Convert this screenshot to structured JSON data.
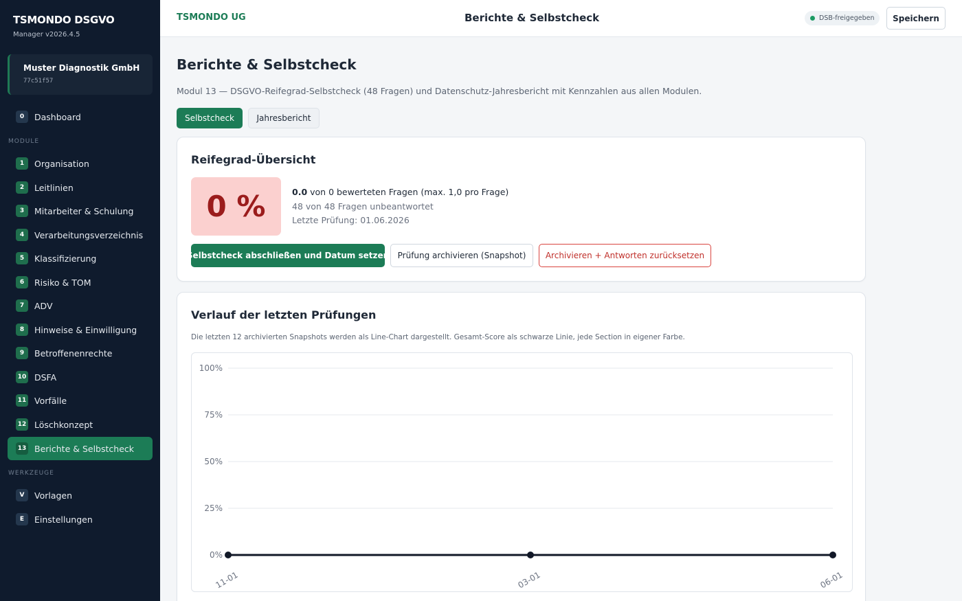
{
  "sidebar": {
    "brand": "TSMONDO DSGVO",
    "version": "Manager v2026.4.5",
    "org": {
      "name": "Muster Diagnostik GmbH",
      "id": "77c51f57"
    },
    "dashboard": {
      "badge": "0",
      "label": "Dashboard"
    },
    "section_modules": "MODULE",
    "modules": [
      {
        "badge": "1",
        "label": "Organisation"
      },
      {
        "badge": "2",
        "label": "Leitlinien"
      },
      {
        "badge": "3",
        "label": "Mitarbeiter & Schulung"
      },
      {
        "badge": "4",
        "label": "Verarbeitungsverzeichnis"
      },
      {
        "badge": "5",
        "label": "Klassifizierung"
      },
      {
        "badge": "6",
        "label": "Risiko & TOM"
      },
      {
        "badge": "7",
        "label": "ADV"
      },
      {
        "badge": "8",
        "label": "Hinweise & Einwilligung"
      },
      {
        "badge": "9",
        "label": "Betroffenenrechte"
      },
      {
        "badge": "10",
        "label": "DSFA"
      },
      {
        "badge": "11",
        "label": "Vorfälle"
      },
      {
        "badge": "12",
        "label": "Löschkonzept"
      },
      {
        "badge": "13",
        "label": "Berichte & Selbstcheck"
      }
    ],
    "section_tools": "WERKZEUGE",
    "tools": [
      {
        "badge": "V",
        "label": "Vorlagen"
      },
      {
        "badge": "E",
        "label": "Einstellungen"
      }
    ]
  },
  "header": {
    "company": "TSMONDO UG",
    "title": "Berichte & Selbstcheck",
    "status": "DSB-freigegeben",
    "save_label": "Speichern"
  },
  "main": {
    "title": "Berichte & Selbstcheck",
    "subtitle": "Modul 13 — DSGVO-Reifegrad-Selbstcheck (48 Fragen) und Datenschutz-Jahresbericht mit Kennzahlen aus allen Modulen.",
    "tabs": [
      {
        "label": "Selbstcheck"
      },
      {
        "label": "Jahresbericht"
      }
    ]
  },
  "overview": {
    "title": "Reifegrad-Übersicht",
    "score": "0 %",
    "points": "0.0",
    "points_text": " von 0 bewerteten Fragen (max. 1,0 pro Frage)",
    "unanswered": "48 von 48 Fragen unbeantwortet",
    "last_check": "Letzte Prüfung: 01.06.2026",
    "btn_complete": "Selbstcheck abschließen und Datum setzen",
    "btn_archive": "Prüfung archivieren (Snapshot)",
    "btn_reset": "Archivieren + Antworten zurücksetzen"
  },
  "history": {
    "title": "Verlauf der letzten Prüfungen",
    "description": "Die letzten 12 archivierten Snapshots werden als Line-Chart dargestellt. Gesamt-Score als schwarze Linie, jede Section in eigener Farbe."
  },
  "chart_data": {
    "type": "line",
    "x": [
      "11-01",
      "03-01",
      "06-01"
    ],
    "series": [
      {
        "values": [
          0,
          0,
          0
        ],
        "color": "#111827"
      }
    ],
    "yticks": [
      "0%",
      "25%",
      "50%",
      "75%",
      "100%"
    ],
    "ylim": [
      0,
      100
    ],
    "grid": true,
    "title": "",
    "xlabel": "",
    "ylabel": ""
  },
  "colors": {
    "accent": "#1c7c56",
    "sidebar_bg": "#0f1b2d",
    "danger": "#c0302b",
    "score_bg": "#fbd0cf"
  }
}
